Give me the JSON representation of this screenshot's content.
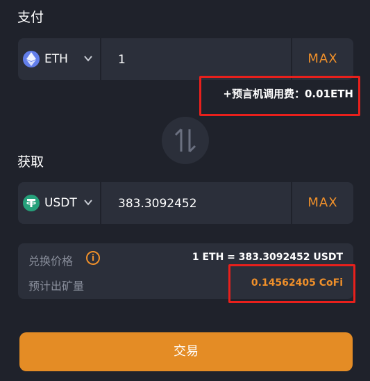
{
  "pay": {
    "title": "支付",
    "token": {
      "symbol": "ETH",
      "icon": "ethereum-icon",
      "color": "#627eea"
    },
    "amount": "1",
    "max_label": "MAX",
    "fee_text": "+预言机调用费：0.01ETH"
  },
  "swap_icon": "swap-arrows-icon",
  "receive": {
    "title": "获取",
    "token": {
      "symbol": "USDT",
      "icon": "tether-icon",
      "color": "#26a17b"
    },
    "amount": "383.3092452",
    "max_label": "MAX"
  },
  "info": {
    "rate_label": "兑换价格",
    "rate_value": "1 ETH = 383.3092452 USDT",
    "mining_label": "预计出矿量",
    "mining_value": "0.14562405 CoFi"
  },
  "trade_button": "交易",
  "colors": {
    "background": "#1f222b",
    "panel": "#2b2f3a",
    "accent": "#e48c25",
    "highlight_box": "#e8201c"
  }
}
